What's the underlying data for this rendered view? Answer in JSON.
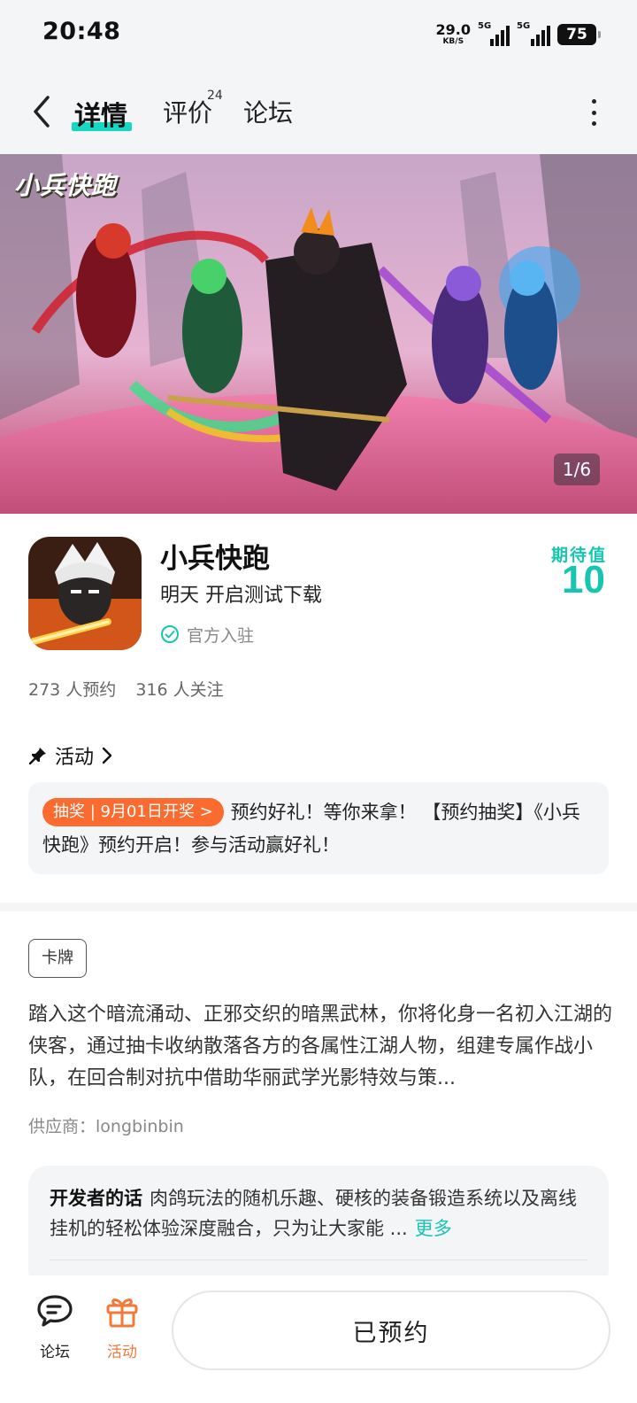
{
  "status_bar": {
    "time": "20:48",
    "net_speed": "29.0",
    "net_unit": "KB/S",
    "signal1_tag": "5G",
    "signal2_tag": "5G",
    "battery": "75"
  },
  "nav": {
    "tab_detail": "详情",
    "tab_review": "评价",
    "review_count": "24",
    "tab_forum": "论坛",
    "back_icon": "chevron-left-icon",
    "more_icon": "more-vertical-icon",
    "accent_color": "#16d7c2"
  },
  "banner": {
    "logo_text": "小兵快跑",
    "counter": "1/6"
  },
  "app": {
    "name": "小兵快跑",
    "release_info": "明天 开启测试下载",
    "official_label": "官方入驻",
    "expect_label": "期待值",
    "expect_value": "10",
    "reservations": "273 人预约",
    "followers": "316 人关注"
  },
  "activity": {
    "heading": "活动",
    "badge": "抽奖 | 9月01日开奖 >",
    "text": "预约好礼！等你来拿！ 【预约抽奖】《小兵快跑》预约开启！参与活动赢好礼！",
    "badge_color": "#fb6a2e"
  },
  "details": {
    "genre_tag": "卡牌",
    "description": "踏入这个暗流涌动、正邪交织的暗黑武林，你将化身一名初入江湖的侠客，通过抽卡收纳散落各方的各属性江湖人物，组建专属作战小队，在回合制对抗中借助华丽武学光影特效与策...",
    "supplier": "供应商：longbinbin"
  },
  "developer": {
    "label": "开发者的话",
    "text": "肉鸽玩法的随机乐趣、硬核的装备锻造系统以及离线挂机的轻松体验深度融合，只为让大家能 ...",
    "more": "更多"
  },
  "bottom_bar": {
    "forum_label": "论坛",
    "activity_label": "活动",
    "reserved_label": "已预约",
    "activity_color": "#f07a3a"
  }
}
